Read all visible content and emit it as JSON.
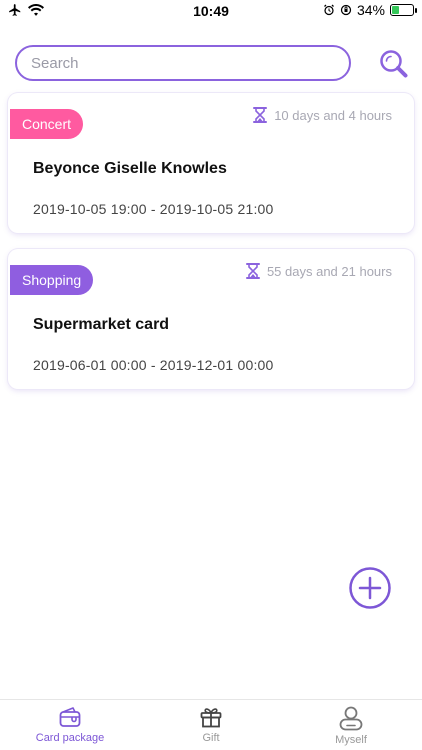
{
  "status_bar": {
    "time": "10:49",
    "battery_percent": "34%",
    "battery_level": 0.34
  },
  "search": {
    "placeholder": "Search"
  },
  "cards": [
    {
      "tag": "Concert",
      "tag_color": "#ff5aa0",
      "countdown": "10 days and 4 hours",
      "title": "Beyonce Giselle Knowles",
      "time_range": "2019-10-05 19:00 - 2019-10-05 21:00"
    },
    {
      "tag": "Shopping",
      "tag_color": "#8f5ee0",
      "countdown": "55 days and 21 hours",
      "title": "Supermarket card",
      "time_range": "2019-06-01 00:00 - 2019-12-01 00:00"
    }
  ],
  "tabs": [
    {
      "label": "Card package",
      "icon": "wallet-icon",
      "active": true
    },
    {
      "label": "Gift",
      "icon": "gift-icon",
      "active": false
    },
    {
      "label": "Myself",
      "icon": "person-icon",
      "active": false
    }
  ],
  "colors": {
    "accent": "#8b63de",
    "tab_active": "#7d57d6",
    "tab_inactive": "#999999"
  }
}
